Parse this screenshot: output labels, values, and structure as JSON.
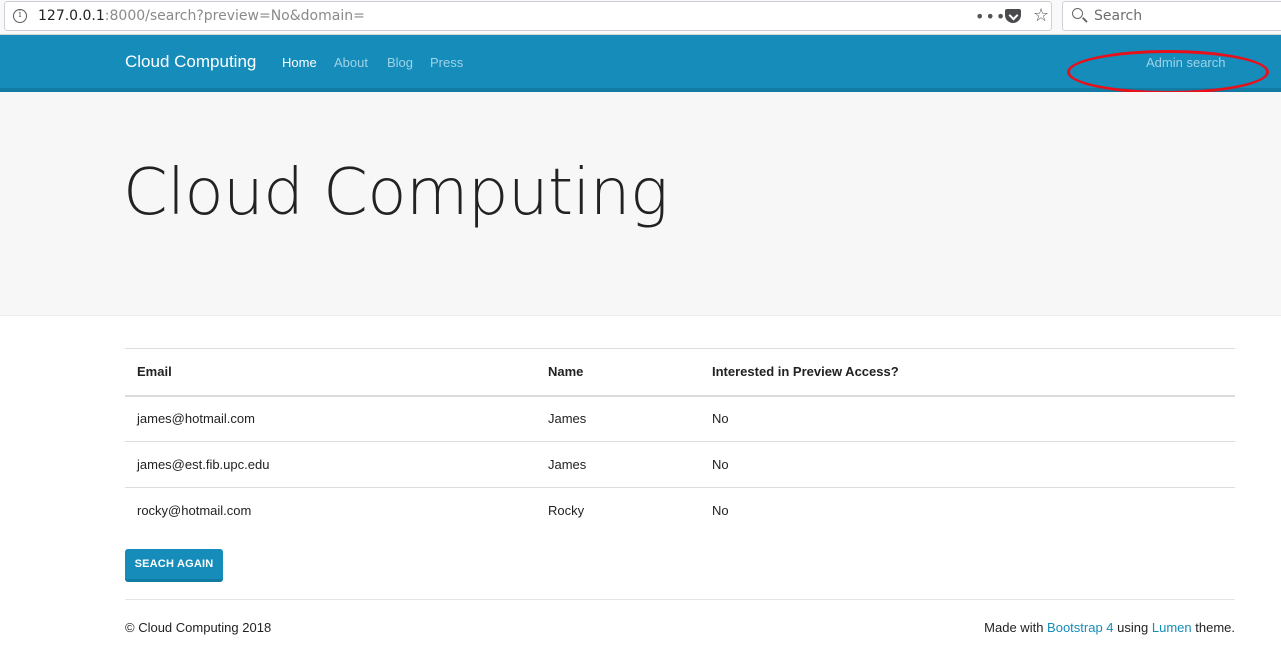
{
  "browser": {
    "url_host": "127.0.0.1",
    "url_rest": ":8000/search?preview=No&domain=",
    "page_actions": "•••",
    "bookmark_star": "☆",
    "search_placeholder": "Search"
  },
  "navbar": {
    "brand": "Cloud Computing",
    "links": [
      {
        "label": "Home",
        "active": true
      },
      {
        "label": "About"
      },
      {
        "label": "Blog"
      },
      {
        "label": "Press"
      }
    ],
    "admin_link": "Admin search",
    "highlight_color": "#e8101a",
    "bg_color": "#158cba"
  },
  "jumbotron": {
    "title": "Cloud Computing"
  },
  "table": {
    "headers": [
      "Email",
      "Name",
      "Interested in Preview Access?"
    ],
    "rows": [
      [
        "james@hotmail.com",
        "James",
        "No"
      ],
      [
        "james@est.fib.upc.edu",
        "James",
        "No"
      ],
      [
        "rocky@hotmail.com",
        "Rocky",
        "No"
      ]
    ]
  },
  "search_again_label": "SEACH AGAIN",
  "footer": {
    "copyright": "© Cloud Computing 2018",
    "made_with": "Made with",
    "bootstrap_link": "Bootstrap 4",
    "using": "using",
    "lumen_link": "Lumen",
    "theme": "theme."
  }
}
